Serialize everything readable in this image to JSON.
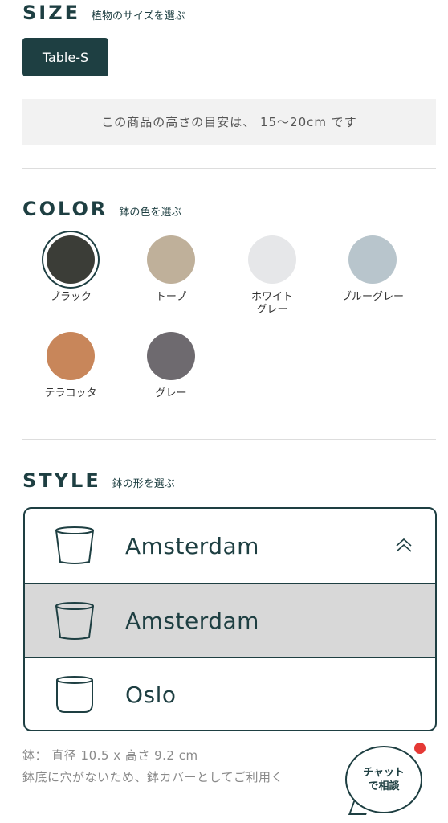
{
  "size": {
    "title": "SIZE",
    "subtitle": "植物のサイズを選ぶ",
    "selected": "Table-S",
    "height_note": "この商品の高さの目安は、 15〜20cm です"
  },
  "color": {
    "title": "COLOR",
    "subtitle": "鉢の色を選ぶ",
    "options": [
      {
        "label": "ブラック",
        "hex": "#3b3d37",
        "selected": true
      },
      {
        "label": "トープ",
        "hex": "#bfb09a",
        "selected": false
      },
      {
        "label": "ホワイト\nグレー",
        "hex": "#e6e7e9",
        "selected": false
      },
      {
        "label": "ブルーグレー",
        "hex": "#b8c5cc",
        "selected": false
      },
      {
        "label": "テラコッタ",
        "hex": "#c8865a",
        "selected": false
      },
      {
        "label": "グレー",
        "hex": "#6e6a6f",
        "selected": false
      }
    ]
  },
  "style": {
    "title": "STYLE",
    "subtitle": "鉢の形を選ぶ",
    "current": "Amsterdam",
    "options": [
      "Amsterdam",
      "Oslo"
    ]
  },
  "specs": {
    "line1": "鉢： 直径 10.5 x 高さ 9.2 cm",
    "line2": "鉢底に穴がないため、鉢カバーとしてご利用く"
  },
  "chat": {
    "line1": "チャット",
    "line2": "で相談"
  },
  "colors": {
    "accent": "#1e3f42",
    "notification": "#e53935"
  }
}
